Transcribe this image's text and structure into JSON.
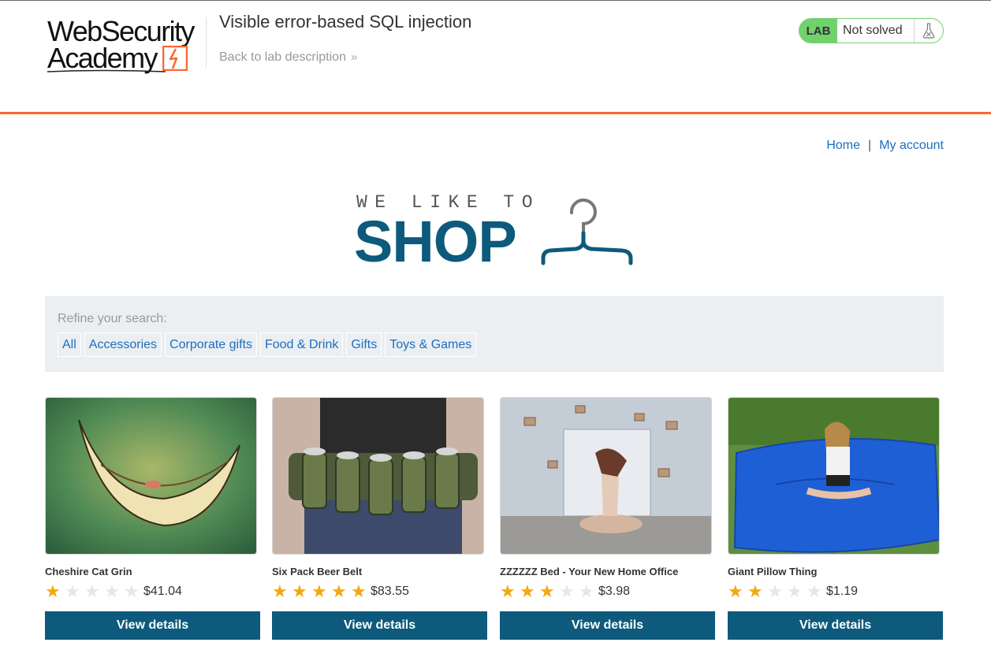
{
  "lab_header": {
    "logo": {
      "line1": "WebSecurity",
      "line2": "Academy"
    },
    "title": "Visible error-based SQL injection",
    "back_link": "Back to lab description",
    "status_badge": "LAB",
    "status_text": "Not solved",
    "status_icon": "flask-icon",
    "colors": {
      "badge_green": "#70d16d",
      "accent_orange": "#ff6633"
    }
  },
  "nav": {
    "home": "Home",
    "separator": "|",
    "account": "My account"
  },
  "shop_logo": {
    "tagline": "WE LIKE TO",
    "word": "SHOP",
    "icon": "hanger-icon"
  },
  "filters": {
    "label": "Refine your search:",
    "items": [
      "All",
      "Accessories",
      "Corporate gifts",
      "Food & Drink",
      "Gifts",
      "Toys & Games"
    ]
  },
  "products": [
    {
      "name": "Cheshire Cat Grin",
      "rating": 1,
      "max_rating": 5,
      "price": "$41.04",
      "button": "View details"
    },
    {
      "name": "Six Pack Beer Belt",
      "rating": 5,
      "max_rating": 5,
      "price": "$83.55",
      "button": "View details"
    },
    {
      "name": "ZZZZZZ Bed - Your New Home Office",
      "rating": 3,
      "max_rating": 5,
      "price": "$3.98",
      "button": "View details"
    },
    {
      "name": "Giant Pillow Thing",
      "rating": 2,
      "max_rating": 5,
      "price": "$1.19",
      "button": "View details"
    }
  ],
  "colors": {
    "primary_blue": "#0d5a7c",
    "link_blue": "#1d6dbf",
    "star_gold": "#f4a80f"
  }
}
